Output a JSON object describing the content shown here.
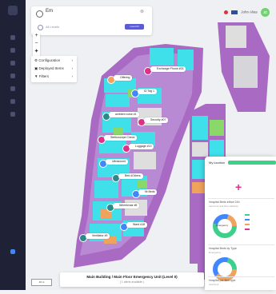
{
  "search": {
    "value": "Em",
    "sub_label": "All Levels",
    "tag": "Level 04"
  },
  "layers": [
    {
      "label": "Configuration",
      "icon": "gear-icon"
    },
    {
      "label": "Deployed Items",
      "icon": "box-icon"
    },
    {
      "label": "Filters",
      "icon": "filter-icon"
    }
  ],
  "zoom": {
    "in": "+",
    "out": "−",
    "compass": "✦"
  },
  "user": {
    "name": "John Alias",
    "initials": "JD"
  },
  "map_labels": [
    {
      "text": "Exchange Phone #03"
    },
    {
      "text": "Offering"
    },
    {
      "text": "ID Tag 1"
    },
    {
      "text": "ambient noise #1"
    },
    {
      "text": "Security #07"
    },
    {
      "text": "Stethoscope Check"
    },
    {
      "text": "Luggage #13"
    },
    {
      "text": "Ultrasound"
    },
    {
      "text": "Bed #Others"
    },
    {
      "text": "Nt Beds"
    },
    {
      "text": "Wheelchair #8"
    },
    {
      "text": "Ward #18"
    },
    {
      "text": "Ventilator #9"
    }
  ],
  "footer": {
    "title": "Main Building / Main Floor Emergency Unit (Level 0)",
    "sub": "( 1 alerts available )"
  },
  "scale_label": "10 m",
  "panel": {
    "title": "My location",
    "card1_title": "Hospital Beds Inflow 24h",
    "card1_sub": "Last hour and flow statistics",
    "card2_title": "Hospital Beds by Type",
    "card2_sub": "Emergency",
    "card3_title": "Hospital per Bed type",
    "card3_sub": "Last hour",
    "donut_label": "Emergency"
  },
  "colors": {
    "purple": "#a96ac4",
    "cyan": "#3fe0ea",
    "green": "#8ad86a",
    "orange": "#f0a35c",
    "pink": "#e0308a",
    "sidebar": "#1f2236"
  }
}
